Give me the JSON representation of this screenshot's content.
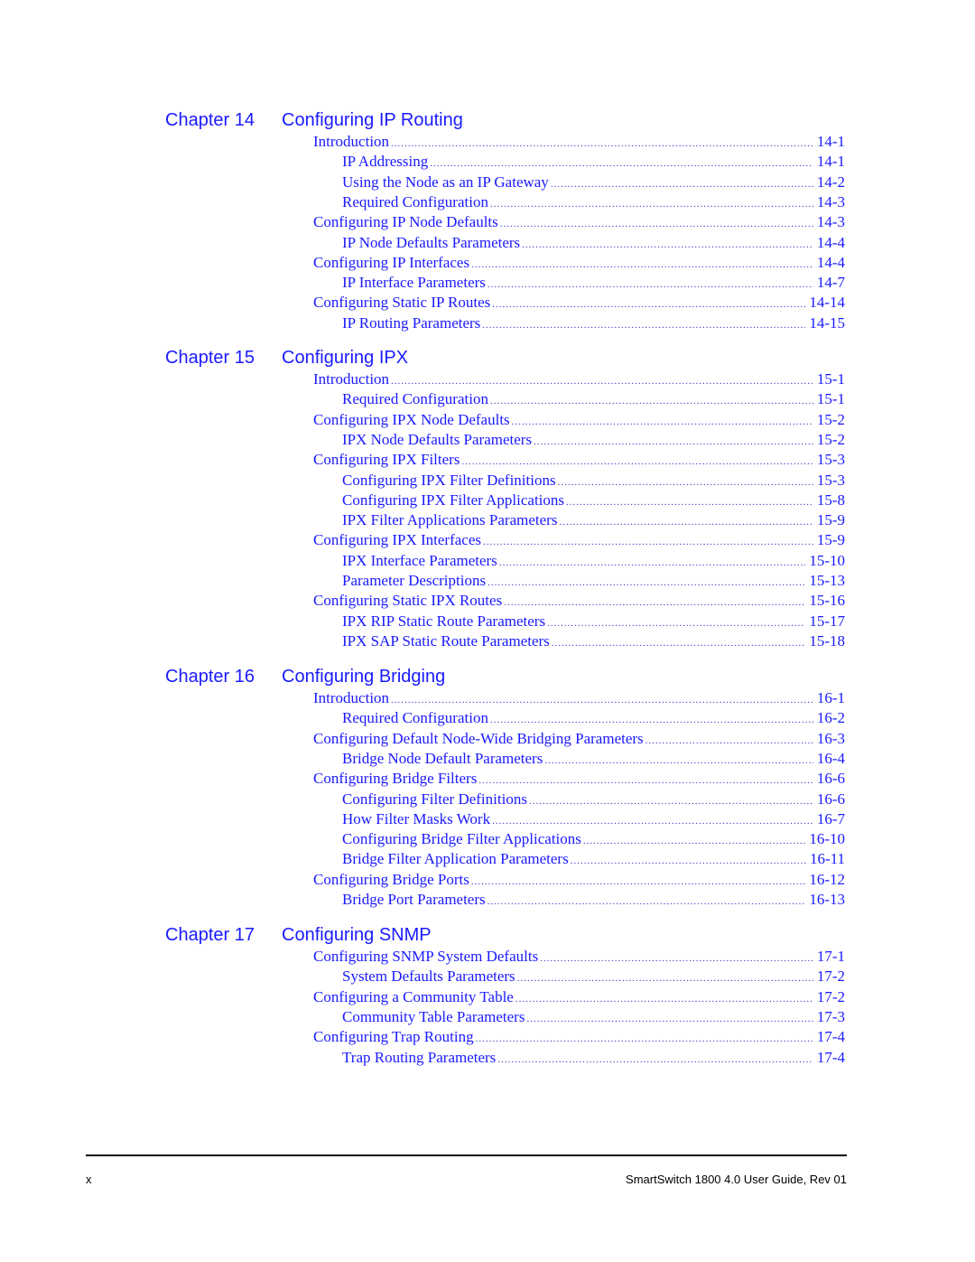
{
  "chapters": [
    {
      "number": "Chapter 14",
      "title": "Configuring IP Routing",
      "entries": [
        {
          "level": 1,
          "label": "Introduction",
          "page": "14-1"
        },
        {
          "level": 2,
          "label": "IP Addressing",
          "page": "14-1"
        },
        {
          "level": 2,
          "label": "Using the Node as an IP Gateway",
          "page": "14-2"
        },
        {
          "level": 2,
          "label": "Required Configuration",
          "page": "14-3"
        },
        {
          "level": 1,
          "label": "Configuring IP Node Defaults",
          "page": "14-3"
        },
        {
          "level": 2,
          "label": "IP Node Defaults Parameters",
          "page": "14-4"
        },
        {
          "level": 1,
          "label": "Configuring IP Interfaces",
          "page": "14-4"
        },
        {
          "level": 2,
          "label": "IP Interface Parameters",
          "page": "14-7"
        },
        {
          "level": 1,
          "label": "Configuring Static IP Routes",
          "page": "14-14"
        },
        {
          "level": 2,
          "label": "IP Routing Parameters",
          "page": "14-15"
        }
      ]
    },
    {
      "number": "Chapter 15",
      "title": "Configuring IPX",
      "entries": [
        {
          "level": 1,
          "label": "Introduction",
          "page": "15-1"
        },
        {
          "level": 2,
          "label": "Required Configuration",
          "page": "15-1"
        },
        {
          "level": 1,
          "label": "Configuring IPX Node Defaults",
          "page": "15-2"
        },
        {
          "level": 2,
          "label": "IPX Node Defaults Parameters",
          "page": "15-2"
        },
        {
          "level": 1,
          "label": "Configuring IPX Filters",
          "page": "15-3"
        },
        {
          "level": 2,
          "label": "Configuring IPX Filter Definitions",
          "page": "15-3"
        },
        {
          "level": 2,
          "label": "Configuring IPX Filter Applications",
          "page": "15-8"
        },
        {
          "level": 2,
          "label": "IPX Filter Applications Parameters",
          "page": "15-9"
        },
        {
          "level": 1,
          "label": "Configuring IPX Interfaces",
          "page": "15-9"
        },
        {
          "level": 2,
          "label": "IPX Interface Parameters",
          "page": "15-10"
        },
        {
          "level": 2,
          "label": "Parameter Descriptions",
          "page": "15-13"
        },
        {
          "level": 1,
          "label": "Configuring Static IPX Routes",
          "page": "15-16"
        },
        {
          "level": 2,
          "label": "IPX RIP Static Route Parameters",
          "page": "15-17"
        },
        {
          "level": 2,
          "label": "IPX SAP Static Route Parameters",
          "page": "15-18"
        }
      ]
    },
    {
      "number": "Chapter 16",
      "title": "Configuring Bridging",
      "entries": [
        {
          "level": 1,
          "label": "Introduction",
          "page": "16-1"
        },
        {
          "level": 2,
          "label": "Required Configuration",
          "page": "16-2"
        },
        {
          "level": 1,
          "label": "Configuring Default Node-Wide Bridging Parameters",
          "page": "16-3"
        },
        {
          "level": 2,
          "label": "Bridge Node Default Parameters",
          "page": "16-4"
        },
        {
          "level": 1,
          "label": "Configuring Bridge Filters",
          "page": "16-6"
        },
        {
          "level": 2,
          "label": "Configuring Filter Definitions",
          "page": "16-6"
        },
        {
          "level": 2,
          "label": "How Filter Masks Work",
          "page": "16-7"
        },
        {
          "level": 2,
          "label": "Configuring Bridge Filter Applications",
          "page": "16-10"
        },
        {
          "level": 2,
          "label": "Bridge Filter Application Parameters",
          "page": "16-11"
        },
        {
          "level": 1,
          "label": "Configuring Bridge Ports",
          "page": "16-12"
        },
        {
          "level": 2,
          "label": "Bridge Port Parameters",
          "page": "16-13"
        }
      ]
    },
    {
      "number": "Chapter 17",
      "title": "Configuring SNMP",
      "entries": [
        {
          "level": 1,
          "label": "Configuring SNMP System Defaults",
          "page": "17-1"
        },
        {
          "level": 2,
          "label": "System Defaults Parameters",
          "page": "17-2"
        },
        {
          "level": 1,
          "label": "Configuring a Community Table",
          "page": "17-2"
        },
        {
          "level": 2,
          "label": "Community Table Parameters",
          "page": "17-3"
        },
        {
          "level": 1,
          "label": "Configuring Trap Routing",
          "page": "17-4"
        },
        {
          "level": 2,
          "label": "Trap Routing Parameters",
          "page": "17-4"
        }
      ]
    }
  ],
  "footer": {
    "page_number": "x",
    "document_title": "SmartSwitch 1800 4.0 User Guide, Rev 01"
  },
  "colors": {
    "link_text": "#1a1aff",
    "footer_text": "#000000"
  }
}
